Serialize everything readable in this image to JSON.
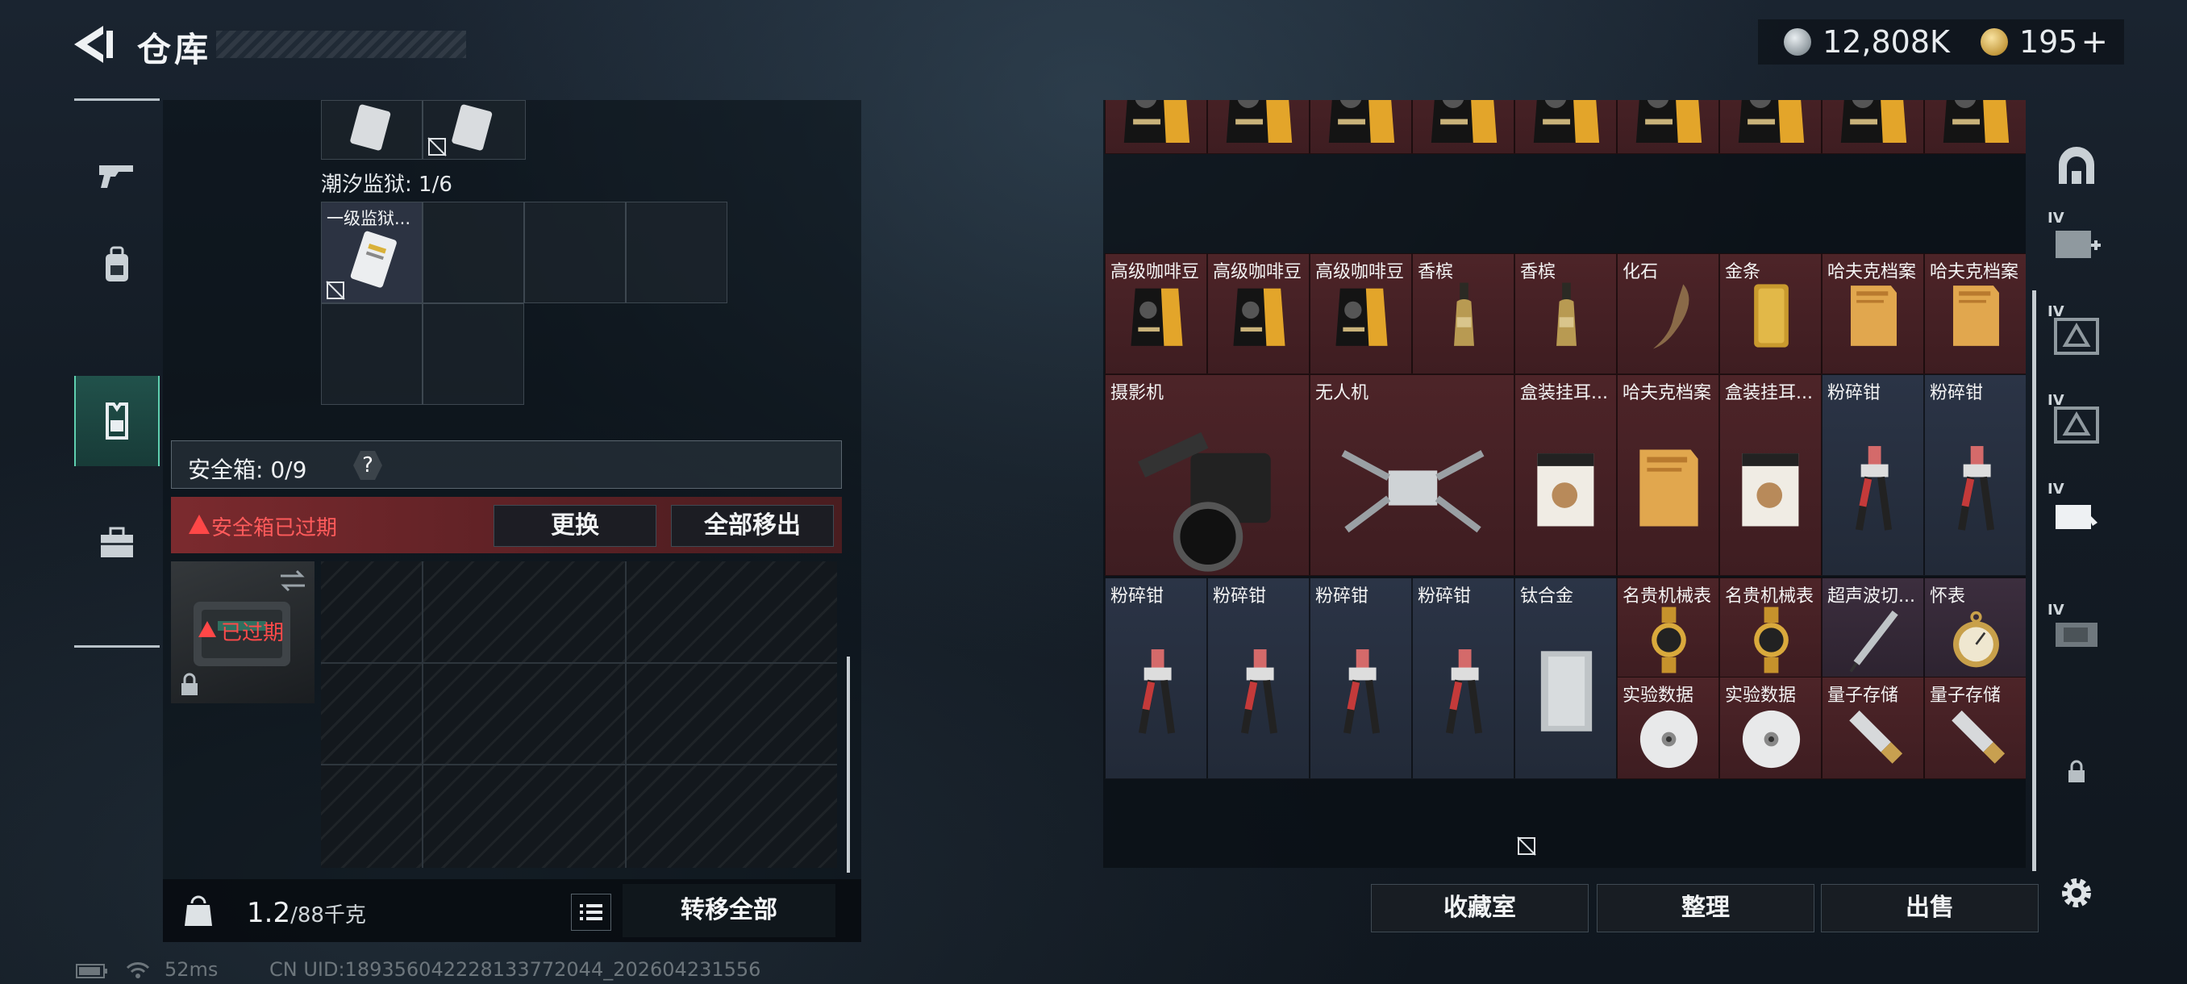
{
  "header": {
    "title": "仓库",
    "currency": [
      {
        "icon": "silver-coin-icon",
        "amount": "12,808K"
      },
      {
        "icon": "gold-coin-icon",
        "amount": "195"
      }
    ],
    "add_symbol": "+"
  },
  "left_nav": [
    {
      "icon": "gun-icon"
    },
    {
      "icon": "backpack-icon"
    },
    {
      "icon": "vest-icon",
      "active": true
    },
    {
      "icon": "briefcase-icon"
    }
  ],
  "left_panel": {
    "prison_label": "潮汐监狱: 1/6",
    "prison_item": "一级监狱...",
    "safe_box_label": "安全箱: 0/9",
    "help": "?",
    "expired_notice": "安全箱已过期",
    "replace_button": "更换",
    "remove_all_button": "全部移出",
    "expired_tag": "已过期",
    "weight_value": "1.2",
    "weight_max": "/88千克",
    "transfer_all_button": "转移全部"
  },
  "storage": {
    "rows": [
      [
        {
          "name": "",
          "art": "coffee",
          "rarity": "red"
        },
        {
          "name": "",
          "art": "coffee",
          "rarity": "red"
        },
        {
          "name": "",
          "art": "coffee",
          "rarity": "red"
        },
        {
          "name": "",
          "art": "coffee",
          "rarity": "red"
        },
        {
          "name": "",
          "art": "coffee",
          "rarity": "red"
        },
        {
          "name": "",
          "art": "coffee",
          "rarity": "red"
        },
        {
          "name": "",
          "art": "coffee",
          "rarity": "red"
        },
        {
          "name": "",
          "art": "coffee",
          "rarity": "red"
        },
        {
          "name": "",
          "art": "coffee",
          "rarity": "red"
        }
      ],
      [
        {
          "name": "高级咖啡豆",
          "art": "coffee",
          "rarity": "red"
        },
        {
          "name": "高级咖啡豆",
          "art": "coffee",
          "rarity": "red"
        },
        {
          "name": "高级咖啡豆",
          "art": "coffee",
          "rarity": "red"
        },
        {
          "name": "香槟",
          "art": "champagne",
          "rarity": "red"
        },
        {
          "name": "香槟",
          "art": "champagne",
          "rarity": "red"
        },
        {
          "name": "化石",
          "art": "fossil",
          "rarity": "red"
        },
        {
          "name": "金条",
          "art": "goldbar",
          "rarity": "red"
        },
        {
          "name": "哈夫克档案",
          "art": "dossier",
          "rarity": "red"
        },
        {
          "name": "哈夫克档案",
          "art": "dossier",
          "rarity": "red"
        }
      ]
    ],
    "row3": [
      {
        "name": "摄影机",
        "art": "camera",
        "rarity": "red"
      },
      {
        "name": "无人机",
        "art": "drone",
        "rarity": "red"
      },
      {
        "name": "盒装挂耳...",
        "art": "coffeebox",
        "rarity": "red"
      },
      {
        "name": "哈夫克档案",
        "art": "dossier",
        "rarity": "red"
      },
      {
        "name": "盒装挂耳...",
        "art": "coffeebox",
        "rarity": "red"
      },
      {
        "name": "粉碎钳",
        "art": "cutter",
        "rarity": "blue"
      },
      {
        "name": "粉碎钳",
        "art": "cutter",
        "rarity": "blue"
      }
    ],
    "row4": [
      {
        "name": "粉碎钳",
        "art": "cutter",
        "rarity": "blue"
      },
      {
        "name": "粉碎钳",
        "art": "cutter",
        "rarity": "blue"
      },
      {
        "name": "粉碎钳",
        "art": "cutter",
        "rarity": "blue"
      },
      {
        "name": "粉碎钳",
        "art": "cutter",
        "rarity": "blue"
      },
      {
        "name": "钛合金",
        "art": "titanium",
        "rarity": "blue"
      },
      {
        "name": "名贵机械表",
        "art": "watch",
        "rarity": "red"
      },
      {
        "name": "名贵机械表",
        "art": "watch",
        "rarity": "red"
      },
      {
        "name": "超声波切...",
        "art": "ultrasonic",
        "rarity": "purple"
      },
      {
        "name": "怀表",
        "art": "pocketwatch",
        "rarity": "purple"
      },
      {
        "name": "实验数据",
        "art": "disc",
        "rarity": "red"
      },
      {
        "name": "实验数据",
        "art": "disc",
        "rarity": "red"
      },
      {
        "name": "量子存储",
        "art": "usb",
        "rarity": "red"
      },
      {
        "name": "量子存储",
        "art": "usb",
        "rarity": "red"
      }
    ],
    "buttons": [
      "收藏室",
      "整理",
      "出售"
    ]
  },
  "right_nav": [
    {
      "icon": "storage-arch-icon",
      "tier": ""
    },
    {
      "icon": "storage-add-icon",
      "tier": "IV"
    },
    {
      "icon": "storage-triangle-icon",
      "tier": "IV"
    },
    {
      "icon": "storage-triangle-icon",
      "tier": "IV"
    },
    {
      "icon": "storage-active-icon",
      "tier": "IV"
    },
    {
      "icon": "storage-box-icon",
      "tier": "IV"
    },
    {
      "icon": "lock-icon",
      "tier": ""
    },
    {
      "icon": "settings-gear-icon",
      "tier": ""
    }
  ],
  "status_bar": {
    "ping": "52ms",
    "uid": "CN UID:189356042228133772044_202604231556"
  },
  "colors": {
    "danger": "#ff4a4a",
    "accent": "#5fd0b0",
    "rarity_red": "#4d2428",
    "rarity_gold": "#5c3e22",
    "rarity_purple": "#3c2e3e",
    "rarity_blue": "#2b3446"
  }
}
